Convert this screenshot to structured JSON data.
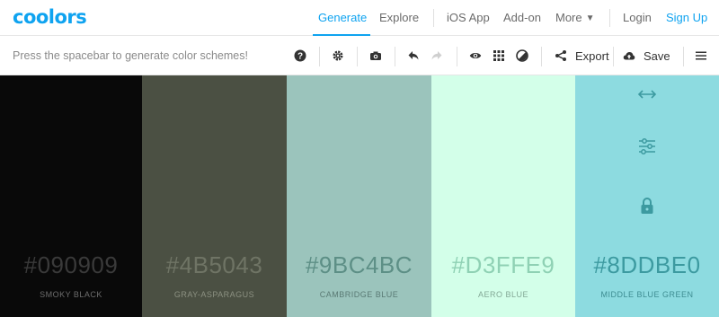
{
  "app": {
    "logo": "coolors",
    "nav": {
      "generate": "Generate",
      "explore": "Explore",
      "ios_app": "iOS App",
      "addon": "Add-on",
      "more": "More",
      "login": "Login",
      "signup": "Sign Up"
    },
    "accent": "#0fa3f0"
  },
  "toolbar": {
    "hint": "Press the spacebar to generate color schemes!",
    "export_label": "Export",
    "save_label": "Save",
    "icons": [
      "help-icon",
      "settings-icon",
      "camera-icon",
      "undo-icon",
      "redo-icon",
      "view-icon",
      "grid-icon",
      "contrast-icon",
      "share-icon",
      "save-cloud-icon",
      "menu-icon"
    ]
  },
  "palette": {
    "swatches": [
      {
        "hex": "#090909",
        "name": "SMOKY BLACK",
        "color": "#090909",
        "text_color": "#3a3a3a",
        "label_color": "#6d6d6d"
      },
      {
        "hex": "#4B5043",
        "name": "GRAY-ASPARAGUS",
        "color": "#4b5043",
        "text_color": "#6f7465",
        "label_color": "#8c9182"
      },
      {
        "hex": "#9BC4BC",
        "name": "CAMBRIDGE BLUE",
        "color": "#9bc4bc",
        "text_color": "#5d8f86",
        "label_color": "#5a7a74"
      },
      {
        "hex": "#D3FFE9",
        "name": "AERO BLUE",
        "color": "#d3ffe9",
        "text_color": "#8fd1b4",
        "label_color": "#83a896"
      },
      {
        "hex": "#8DDBE0",
        "name": "MIDDLE BLUE GREEN",
        "color": "#8ddbe0",
        "text_color": "#3c9aa0",
        "label_color": "#3d8c91"
      }
    ],
    "active_swatch_icons": [
      "swap-arrows-icon",
      "adjust-sliders-icon",
      "lock-icon"
    ]
  }
}
